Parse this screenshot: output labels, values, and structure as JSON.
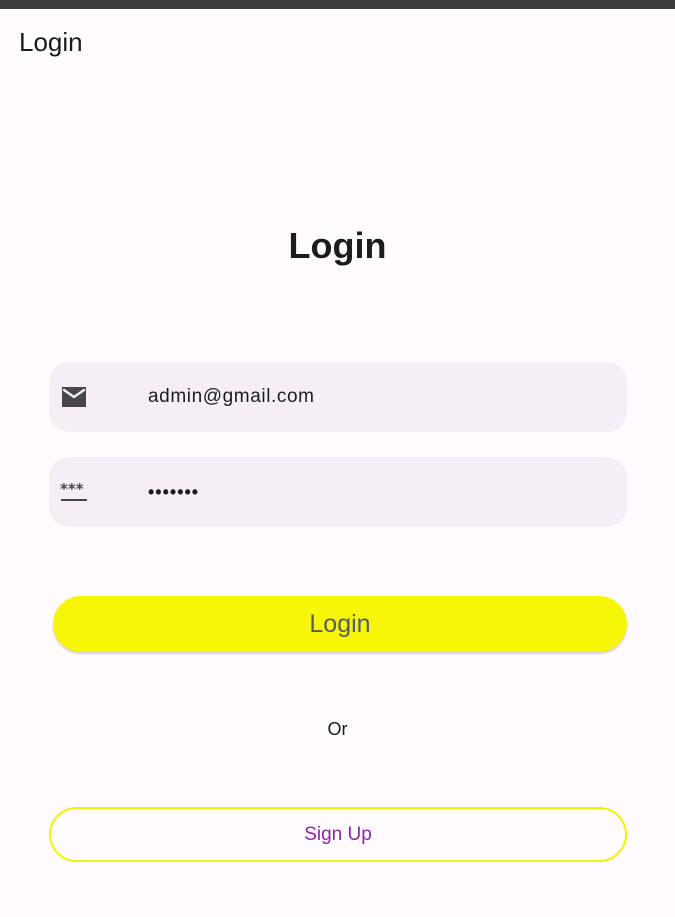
{
  "app_bar": {
    "title": "Login"
  },
  "heading": "Login",
  "email_field": {
    "icon": "email-icon",
    "value": "admin@gmail.com"
  },
  "password_field": {
    "icon": "password-icon",
    "value": "•••••••"
  },
  "login_button": {
    "label": "Login",
    "color": "#f6f606"
  },
  "divider_text": "Or",
  "signup_button": {
    "label": "Sign Up",
    "border_color": "#f2f207",
    "text_color": "#8e24aa"
  }
}
